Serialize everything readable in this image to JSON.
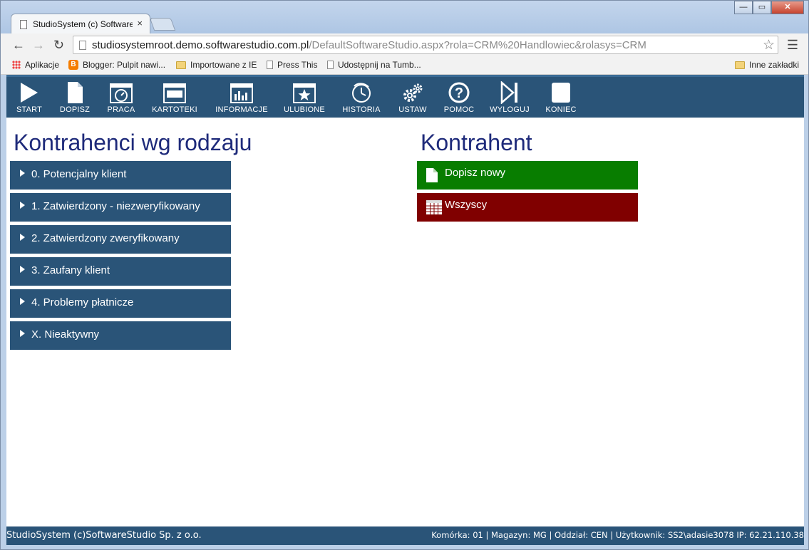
{
  "browser": {
    "tab_title": "StudioSystem (c) Software",
    "tab_close": "×",
    "url_host": "studiosystemroot.demo.softwarestudio.com.pl",
    "url_rest": "/DefaultSoftwareStudio.aspx?rola=CRM%20Handlowiec&rolasys=CRM",
    "bookmarks": {
      "apps": "Aplikacje",
      "blogger": "Blogger: Pulpit nawi...",
      "ie": "Importowane z IE",
      "press": "Press This",
      "tumblr": "Udostępnij na Tumb...",
      "other": "Inne zakładki"
    },
    "window_buttons": {
      "minimize": "—",
      "maximize": "▭",
      "close": "✕"
    }
  },
  "nav": [
    {
      "label": "START",
      "icon": "play-icon"
    },
    {
      "label": "DOPISZ",
      "icon": "document-icon"
    },
    {
      "label": "PRACA",
      "icon": "clock-icon"
    },
    {
      "label": "KARTOTEKI",
      "icon": "window-icon"
    },
    {
      "label": "INFORMACJE",
      "icon": "bar-chart-icon"
    },
    {
      "label": "ULUBIONE",
      "icon": "star-icon"
    },
    {
      "label": "HISTORIA",
      "icon": "history-icon"
    },
    {
      "label": "USTAW",
      "icon": "gears-icon"
    },
    {
      "label": "POMOC",
      "icon": "help-icon"
    },
    {
      "label": "WYLOGUJ",
      "icon": "logout-icon"
    },
    {
      "label": "KONIEC",
      "icon": "stop-icon"
    }
  ],
  "left_panel": {
    "title": "Kontrahenci wg rodzaju",
    "items": [
      "0. Potencjalny klient",
      "1. Zatwierdzony - niezweryfikowany",
      "2. Zatwierdzony zweryfikowany",
      "3. Zaufany klient",
      "4. Problemy płatnicze",
      "X. Nieaktywny"
    ]
  },
  "right_panel": {
    "title": "Kontrahent",
    "add_label": "Dopisz nowy",
    "all_label": "Wszyscy"
  },
  "status": {
    "left": "StudioSystem (c)SoftwareStudio Sp. z o.o.",
    "right": "Komórka: 01 | Magazyn: MG | Oddział: CEN | Użytkownik: SS2\\adasie3078 IP: 62.21.110.38"
  },
  "colors": {
    "app_blue": "#2a5478",
    "title_navy": "#1e2a7a",
    "add_green": "#087d00",
    "all_red": "#800000"
  }
}
